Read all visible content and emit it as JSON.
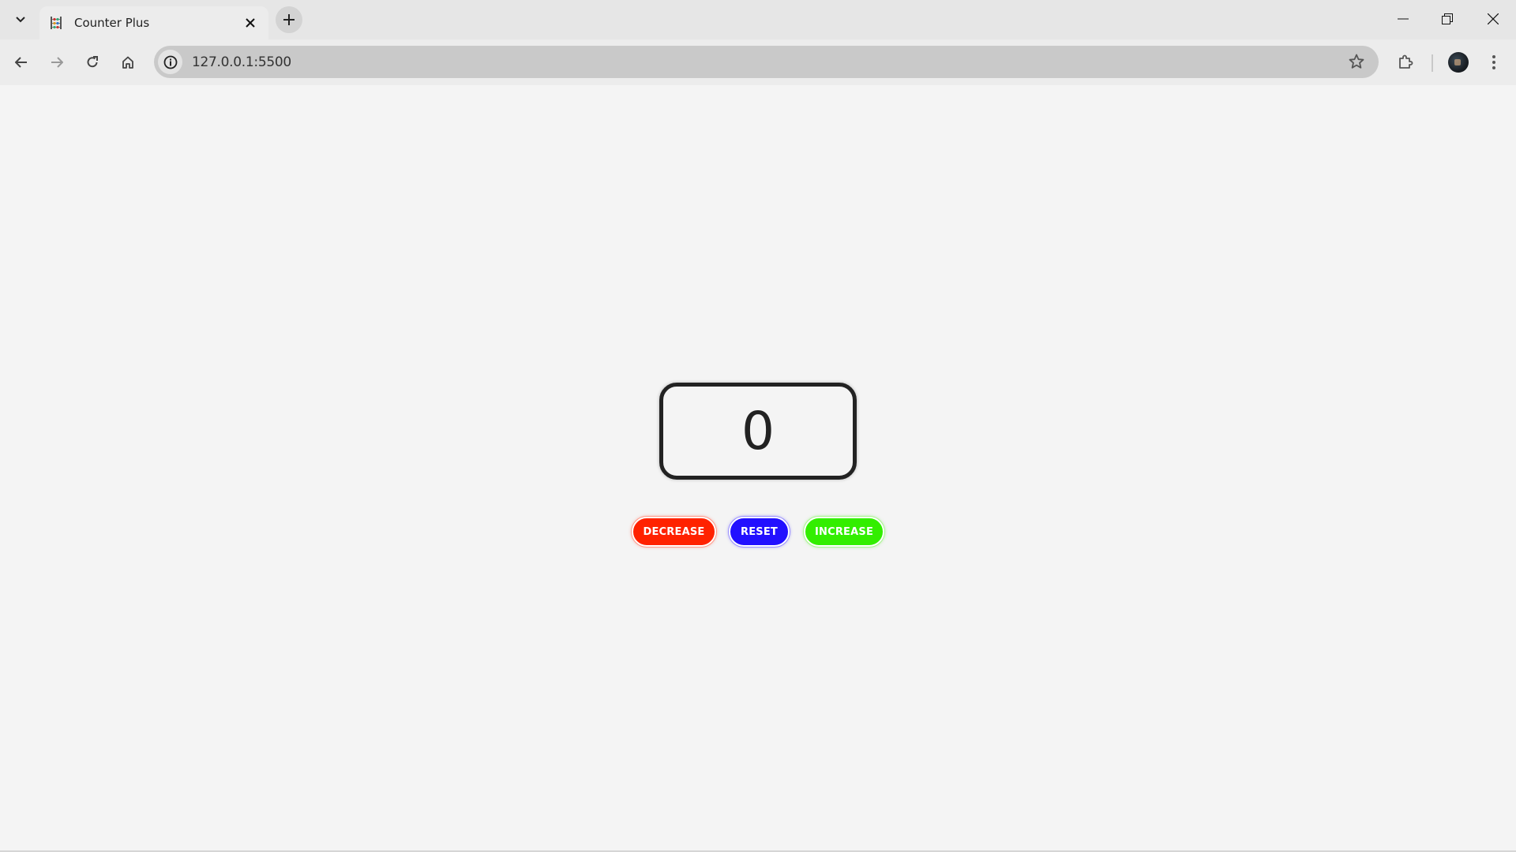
{
  "browser": {
    "tab": {
      "title": "Counter Plus",
      "favicon": "abacus-icon"
    },
    "address_bar": {
      "url": "127.0.0.1:5500",
      "site_info_icon": "info-icon"
    },
    "nav": {
      "back": "back-arrow-icon",
      "forward": "forward-arrow-icon",
      "reload": "reload-icon",
      "home": "home-icon"
    },
    "toolbar_icons": [
      "star-icon",
      "extensions-icon",
      "profile-avatar",
      "menu-icon"
    ],
    "window_controls": [
      "minimize",
      "restore",
      "close"
    ]
  },
  "counter": {
    "value": "0",
    "buttons": {
      "decrease": "DECREASE",
      "reset": "RESET",
      "increase": "INCREASE"
    },
    "colors": {
      "decrease": "#ff2200",
      "reset": "#2210ff",
      "increase": "#33ee00",
      "border": "#222222",
      "background": "#f4f4f4"
    }
  }
}
